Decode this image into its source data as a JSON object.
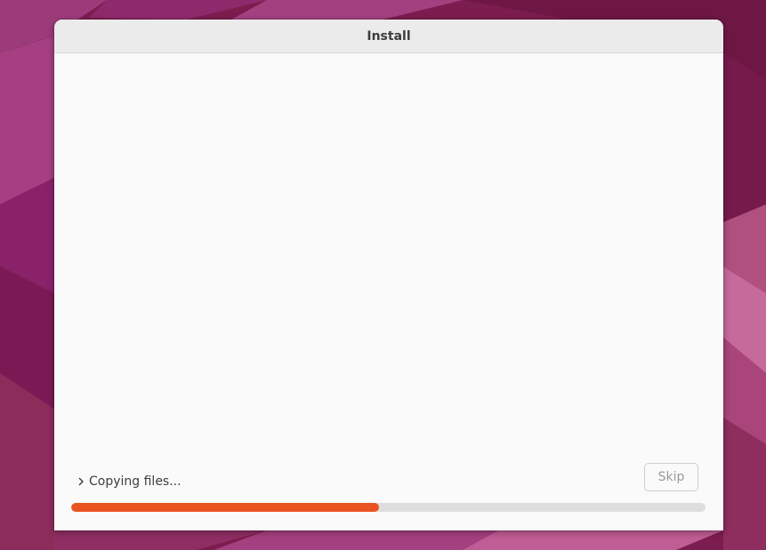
{
  "window": {
    "title": "Install"
  },
  "status": {
    "text": "Copying files...",
    "expander_icon": "chevron-right-icon"
  },
  "skip_button": {
    "label": "Skip",
    "enabled": false
  },
  "progress": {
    "fraction": 0.485,
    "color": "#e95420",
    "track_color": "#dedede"
  },
  "colors": {
    "desktop_background": "#7a1f4e",
    "window_background": "#fafafa",
    "titlebar_background": "#ebebeb"
  }
}
